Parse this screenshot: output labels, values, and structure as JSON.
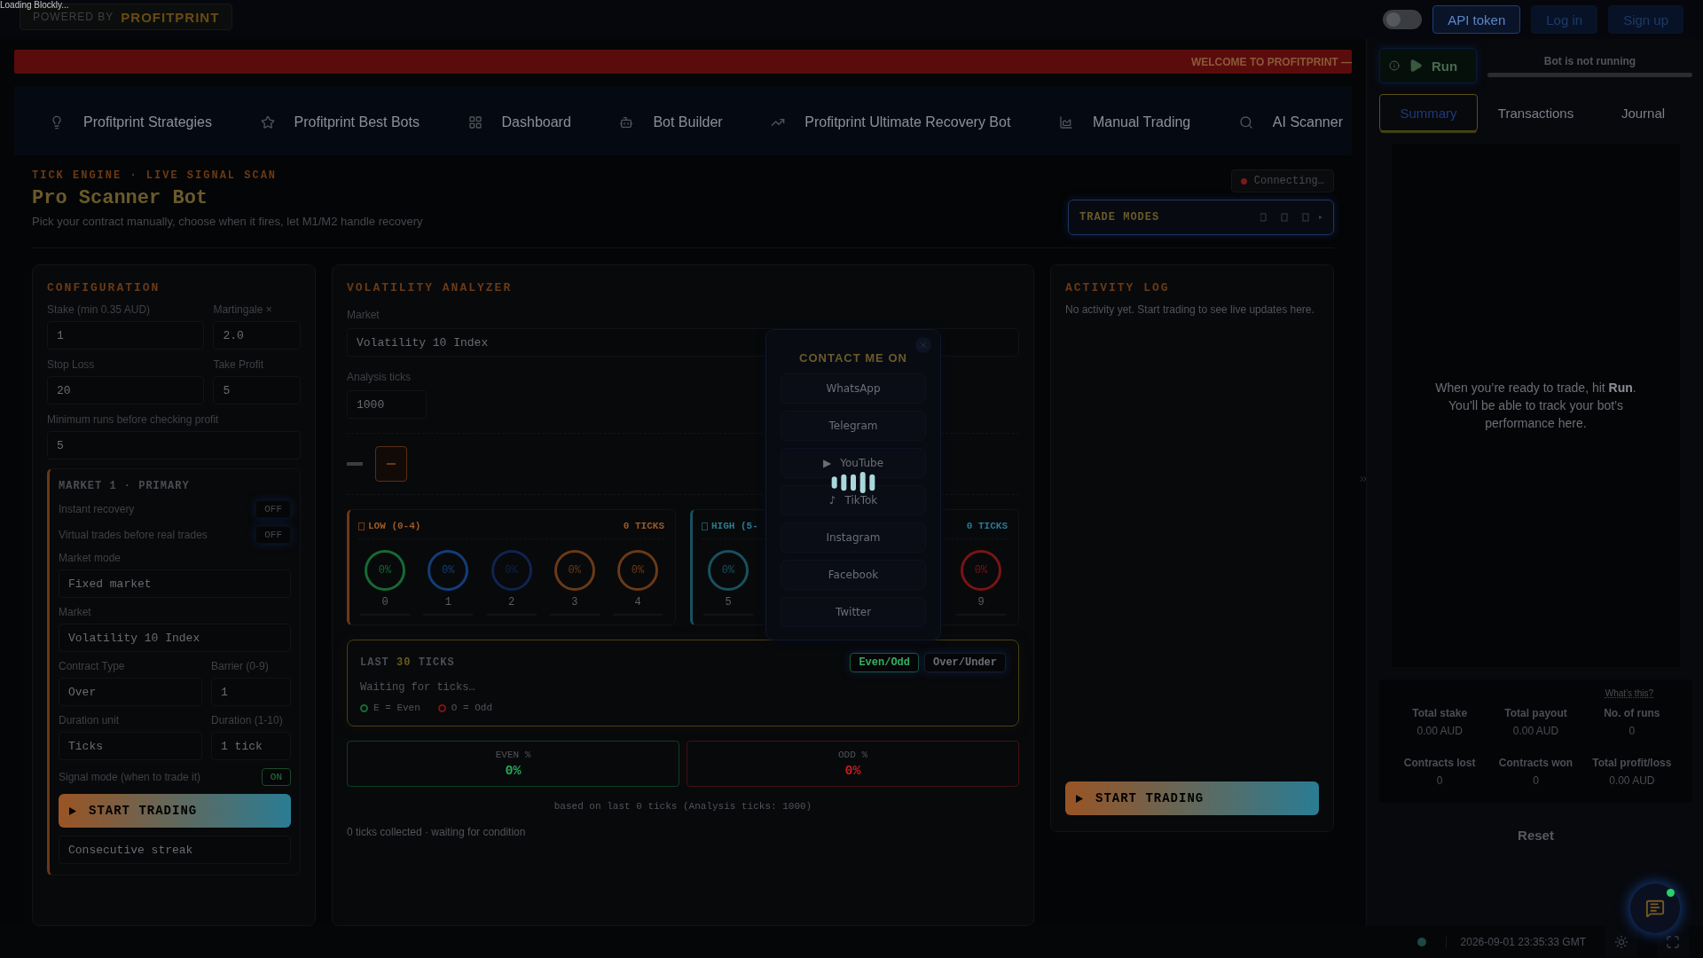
{
  "loading_text": "Loading Blockly...",
  "powered_by": {
    "prefix": "POWERED BY",
    "brand": "PROFITPRINT"
  },
  "top_actions": {
    "theme_toggle_on": false,
    "api_token": "API token",
    "log_in": "Log in",
    "sign_up": "Sign up"
  },
  "banner": "WELCOME TO PROFITPRINT —",
  "nav": [
    {
      "label": "Profitprint Strategies"
    },
    {
      "label": "Profitprint Best Bots"
    },
    {
      "label": "Dashboard"
    },
    {
      "label": "Bot Builder"
    },
    {
      "label": "Profitprint Ultimate Recovery Bot"
    },
    {
      "label": "Manual Trading"
    },
    {
      "label": "AI Scanner"
    }
  ],
  "header": {
    "eyebrow": "TICK ENGINE · LIVE SIGNAL SCAN",
    "title": "Pro Scanner Bot",
    "subtitle": "Pick your contract manually, choose when it fires, let M1/M2 handle recovery",
    "status": "Connecting…",
    "trade_modes": "TRADE MODES"
  },
  "configuration": {
    "title": "CONFIGURATION",
    "rows": [
      [
        {
          "label": "Stake (min 0.35 AUD)",
          "value": "1"
        },
        {
          "label": "Martingale ×",
          "value": "2.0"
        }
      ],
      [
        {
          "label": "Stop Loss",
          "value": "20"
        },
        {
          "label": "Take Profit",
          "value": "5"
        }
      ],
      [
        {
          "label": "Minimum runs before checking profit",
          "value": "5"
        }
      ]
    ],
    "market": {
      "title": "MARKET 1 · PRIMARY",
      "toggles": [
        {
          "label": "Instant recovery",
          "on": false,
          "state_text": "OFF"
        },
        {
          "label": "Virtual trades before real trades",
          "on": false,
          "state_text": "OFF"
        }
      ],
      "rows": [
        [
          {
            "label": "Market mode",
            "value": "Fixed market"
          }
        ],
        [
          {
            "label": "Market",
            "value": "Volatility 10 Index"
          }
        ],
        [
          {
            "label": "Contract Type",
            "value": "Over"
          },
          {
            "label": "Barrier (0-9)",
            "value": "1"
          }
        ],
        [
          {
            "label": "Duration unit",
            "value": "Ticks"
          },
          {
            "label": "Duration (1-10)",
            "value": "1 tick"
          }
        ]
      ],
      "signal": {
        "label": "Signal mode (when to trade it)",
        "on": true,
        "state_text": "ON"
      },
      "start_button": "START TRADING",
      "next_field": "Consecutive streak"
    }
  },
  "analyzer": {
    "title": "VOLATILITY ANALYZER",
    "market": {
      "label": "Market",
      "value": "Volatility 10 Index"
    },
    "analysis_ticks": {
      "label": "Analysis ticks",
      "value": "1000"
    },
    "groups": [
      {
        "name": "LOW (0-4)",
        "count": "0 TICKS",
        "color": "#6a3a16",
        "digits": [
          {
            "digit": "0",
            "pct": "0%",
            "color": "#166a35"
          },
          {
            "digit": "1",
            "pct": "0%",
            "color": "#133d7a"
          },
          {
            "digit": "2",
            "pct": "0%",
            "color": "#0f2450"
          },
          {
            "digit": "3",
            "pct": "0%",
            "color": "#6a3a16"
          },
          {
            "digit": "4",
            "pct": "0%",
            "color": "#6a3a16"
          }
        ]
      },
      {
        "name": "HIGH (5-",
        "count": "0 TICKS",
        "color": "#1a5060",
        "digits": [
          {
            "digit": "5",
            "pct": "0%",
            "color": "#1a5060"
          },
          {
            "digit": "9",
            "pct": "0%",
            "color": "#7a1414"
          }
        ]
      }
    ],
    "last_ticks": {
      "prefix": "LAST",
      "count": "30",
      "suffix": "TICKS",
      "modes": [
        {
          "label": "Even/Odd",
          "selected": true
        },
        {
          "label": "Over/Under",
          "selected": false
        }
      ],
      "waiting": "Waiting for ticks…",
      "legend": [
        {
          "text": "E = Even",
          "color": "#166a35"
        },
        {
          "text": "O = Odd",
          "color": "#7a1414"
        }
      ]
    },
    "stats": [
      {
        "label": "EVEN %",
        "value": "0%",
        "color": "#166a35"
      },
      {
        "label": "ODD %",
        "value": "0%",
        "color": "#7a1414"
      }
    ],
    "footnote": "based on last 0 ticks (Analysis ticks: 1000)",
    "status": "0 ticks collected · waiting for condition"
  },
  "contact": {
    "title": "CONTACT ME ON",
    "items": [
      {
        "label": "WhatsApp"
      },
      {
        "label": "Telegram"
      },
      {
        "label": "YouTube",
        "glyph": "▶"
      },
      {
        "label": "TikTok",
        "glyph": "♪"
      },
      {
        "label": "Instagram"
      },
      {
        "label": "Facebook"
      },
      {
        "label": "Twitter"
      }
    ]
  },
  "activity": {
    "title": "ACTIVITY LOG",
    "empty": "No activity yet. Start trading to see live updates here.",
    "start_button": "START TRADING"
  },
  "sidebar": {
    "run": "Run",
    "status": "Bot is not running",
    "tabs": [
      {
        "label": "Summary",
        "selected": true
      },
      {
        "label": "Transactions",
        "selected": false
      },
      {
        "label": "Journal",
        "selected": false
      }
    ],
    "message": "When you’re ready to trade, hit **Run**. You’ll be able to track your bot’s performance here.",
    "whats_this": "What’s this?",
    "stats": [
      {
        "label": "Total stake",
        "value": "0.00 AUD"
      },
      {
        "label": "Total payout",
        "value": "0.00 AUD"
      },
      {
        "label": "No. of runs",
        "value": "0"
      },
      {
        "label": "Contracts lost",
        "value": "0"
      },
      {
        "label": "Contracts won",
        "value": "0"
      },
      {
        "label": "Total profit/loss",
        "value": "0.00 AUD"
      }
    ],
    "reset": "Reset"
  },
  "status_bar": {
    "timestamp": "2026-09-01 23:35:33 GMT"
  }
}
